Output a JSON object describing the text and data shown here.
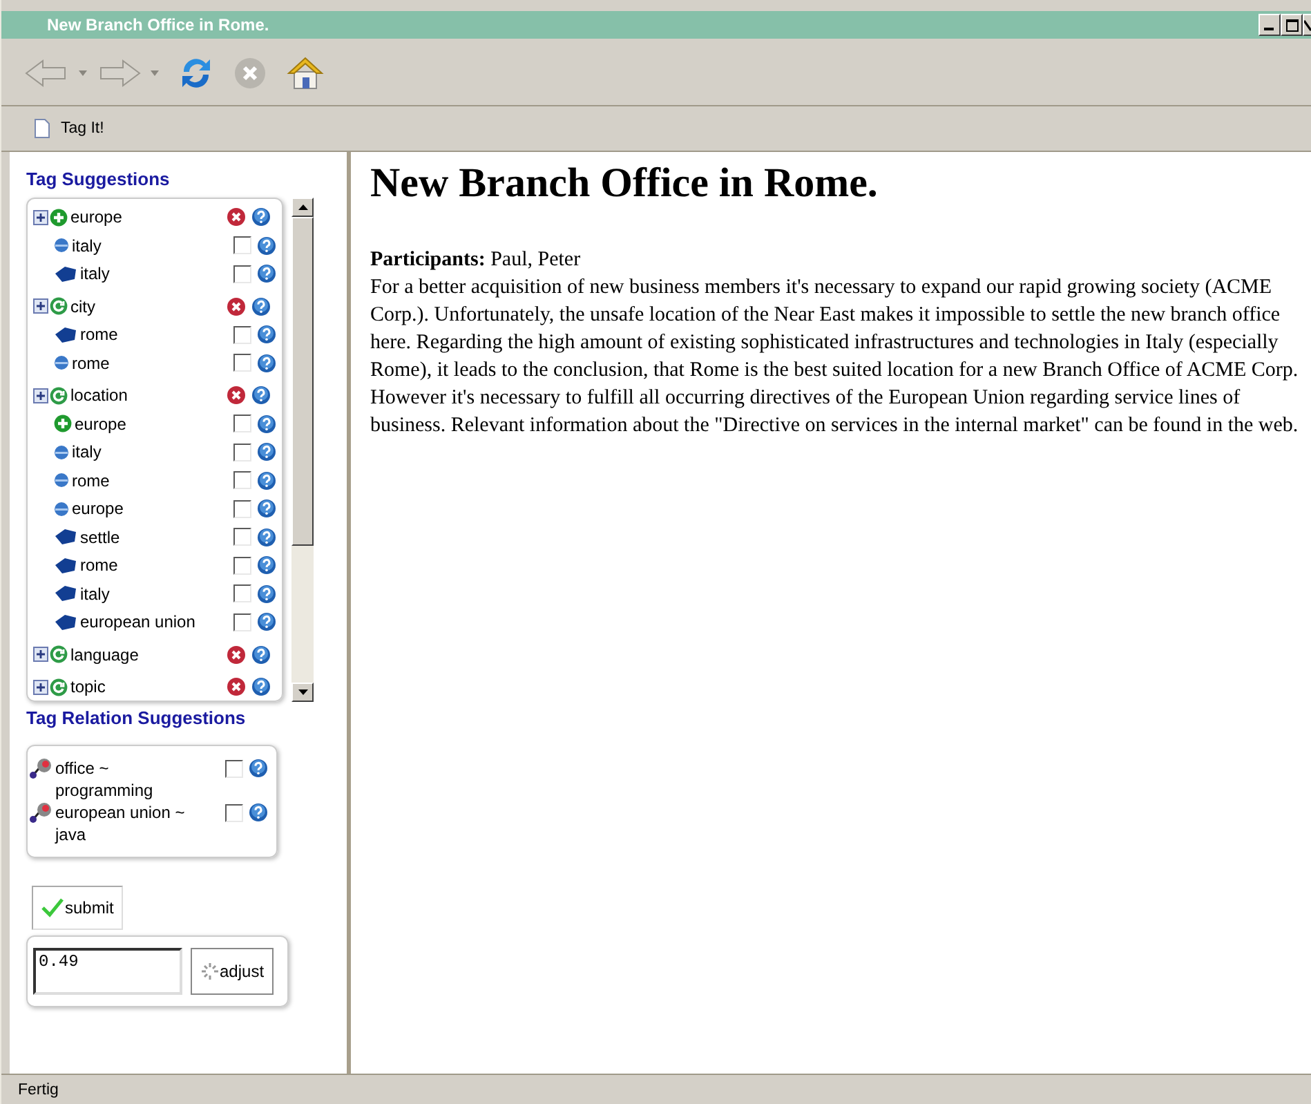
{
  "window": {
    "title": "New Branch Office in Rome."
  },
  "bookmarks": [
    {
      "label": "Tag It!"
    }
  ],
  "tag_suggestions": {
    "heading": "Tag Suggestions",
    "groups": [
      {
        "label": "europe",
        "kind": "plus",
        "children": [
          {
            "label": "italy",
            "kind": "dot",
            "checked": false
          },
          {
            "label": "italy",
            "kind": "tag",
            "checked": false
          }
        ]
      },
      {
        "label": "city",
        "kind": "cycle",
        "children": [
          {
            "label": "rome",
            "kind": "tag",
            "checked": false
          },
          {
            "label": "rome",
            "kind": "dot",
            "checked": false
          }
        ]
      },
      {
        "label": "location",
        "kind": "cycle",
        "children": [
          {
            "label": "europe",
            "kind": "plus",
            "checked": false
          },
          {
            "label": "italy",
            "kind": "dot",
            "checked": false
          },
          {
            "label": "rome",
            "kind": "dot",
            "checked": false
          },
          {
            "label": "europe",
            "kind": "dot",
            "checked": false
          },
          {
            "label": "settle",
            "kind": "tag",
            "checked": false
          },
          {
            "label": "rome",
            "kind": "tag",
            "checked": false
          },
          {
            "label": "italy",
            "kind": "tag",
            "checked": false
          },
          {
            "label": "european union",
            "kind": "tag",
            "checked": false
          }
        ]
      },
      {
        "label": "language",
        "kind": "cycle"
      },
      {
        "label": "topic",
        "kind": "cycle"
      }
    ]
  },
  "tag_relation_suggestions": {
    "heading": "Tag Relation Suggestions",
    "items": [
      {
        "label": "office ~ programming",
        "checked": false
      },
      {
        "label": "european union ~ java",
        "checked": false
      }
    ]
  },
  "submit_button": "submit",
  "threshold": {
    "value": "0.49",
    "button": "adjust"
  },
  "article": {
    "title": "New Branch Office in Rome.",
    "paragraphs": [
      "**Participants:** Paul, Peter",
      "For a better acquisition of new business members it's necessary to expand our rapid growing society (ACME Corp.). Unfortunately, the unsafe location of the Near East makes it impossible to settle the new branch office here. Regarding the high amount of existing sophisticated infrastructures and technologies in Italy (especially Rome), it leads to the conclusion, that Rome is the best suited location for a new Branch Office of ACME Corp.",
      "However it's necessary to fulfill all occurring directives of the European Union regarding service lines of business. Relevant information about the \"Directive on services in the internal market\" can be found in the web."
    ]
  },
  "status_bar": "Fertig"
}
